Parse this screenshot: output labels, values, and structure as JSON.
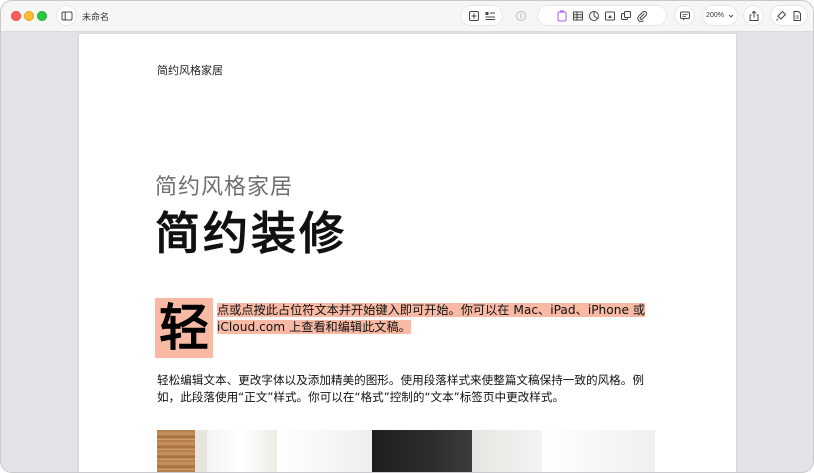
{
  "window": {
    "title": "未命名"
  },
  "toolbar": {
    "zoom": "200%",
    "icons": [
      "sidebar-icon",
      "add-page-icon",
      "insert-list-icon",
      "format-brush-icon",
      "text-box-icon",
      "table-icon",
      "chart-icon",
      "media-icon",
      "shape-icon",
      "attachment-icon",
      "comment-icon",
      "share-icon",
      "format-icon",
      "document-icon"
    ]
  },
  "document": {
    "header": "简约风格家居",
    "subtitle": "简约风格家居",
    "title": "简约装修",
    "drop_cap": "轻",
    "placeholder_text": "点或点按此占位符文本并开始键入即可开始。你可以在 Mac、iPad、iPhone 或 iCloud.com 上查看和编辑此文稿。",
    "body_text": "轻松编辑文本、更改字体以及添加精美的图形。使用段落样式来使整篇文稿保持一致的风格。例如，此段落使用“正文”样式。你可以在“格式”控制的“文本”标签页中更改样式。",
    "highlight_color": "#f8b9a5"
  }
}
